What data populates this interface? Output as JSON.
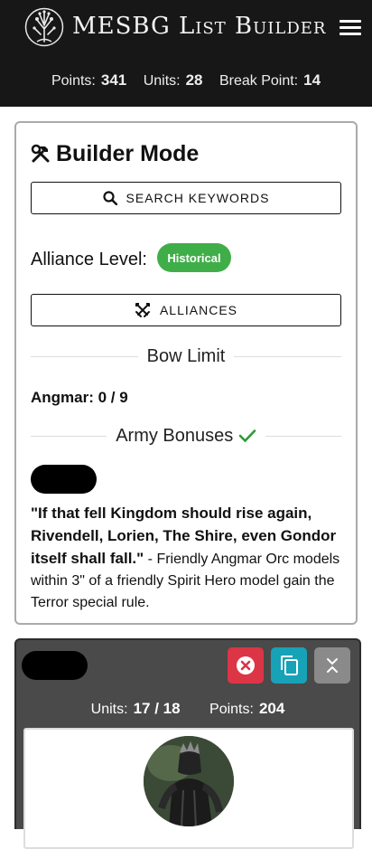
{
  "header": {
    "title": "MESBG List Builder",
    "points_label": "Points:",
    "points_value": "341",
    "units_label": "Units:",
    "units_value": "28",
    "break_point_label": "Break Point:",
    "break_point_value": "14"
  },
  "builder": {
    "title": "Builder Mode",
    "search_button": "SEARCH KEYWORDS",
    "alliance_label": "Alliance Level:",
    "alliance_badge": "Historical",
    "alliances_button": "ALLIANCES",
    "bow_limit_heading": "Bow Limit",
    "bow_limit_text": "Angmar: 0 / 9",
    "army_bonuses_heading": "Army Bonuses",
    "bonus_quote": "\"If that fell Kingdom should rise again, Rivendell, Lorien, The Shire, even Gondor itself shall fall.\"",
    "bonus_text": " - Friendly Angmar Orc models within 3\" of a friendly Spirit Hero model gain the Terror special rule."
  },
  "army_list": {
    "units_label": "Units:",
    "units_value": "17 / 18",
    "points_label": "Points:",
    "points_value": "204"
  },
  "colors": {
    "header_bg": "#171717",
    "historical_green": "#3fae49",
    "delete_red": "#dc3545",
    "copy_cyan": "#17a2b8",
    "collapse_gray": "#8a8a8a",
    "list_bg": "#4a4a4a"
  }
}
